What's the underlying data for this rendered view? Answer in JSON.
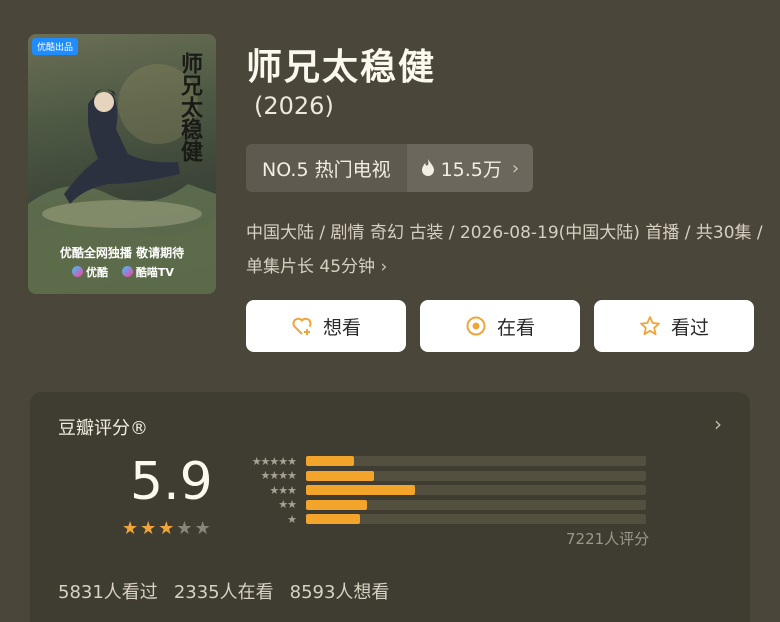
{
  "poster": {
    "badge": "优酷出品",
    "title": "师兄太稳健",
    "caption": "优酷全网独播 敬请期待",
    "logo_youku": "优酷",
    "logo_kumiao": "酷喵TV"
  },
  "show": {
    "title": "师兄太稳健",
    "year": "(2026)"
  },
  "rank": {
    "label": "NO.5 热门电视",
    "heat": "15.5万",
    "heat_icon": "flame-icon",
    "chevron_icon": "chevron-right-icon"
  },
  "meta": {
    "text": "中国大陆 / 剧情 奇幻 古装 / 2026-08-19(中国大陆) 首播 / 共30集 / 单集片长 45分钟"
  },
  "actions": {
    "want": "想看",
    "watching": "在看",
    "watched": "看过"
  },
  "rating": {
    "header": "豆瓣评分®",
    "score": "5.9",
    "stars_filled": 3,
    "stars_total": 5,
    "distribution": [
      {
        "stars": 5,
        "fraction": 0.14
      },
      {
        "stars": 4,
        "fraction": 0.2
      },
      {
        "stars": 3,
        "fraction": 0.32
      },
      {
        "stars": 2,
        "fraction": 0.18
      },
      {
        "stars": 1,
        "fraction": 0.16
      }
    ],
    "count_text": "7221人评分",
    "bar_color": "#f3a42b"
  },
  "stats": {
    "watched": "5831人看过",
    "watching": "2335人在看",
    "want": "8593人想看"
  }
}
